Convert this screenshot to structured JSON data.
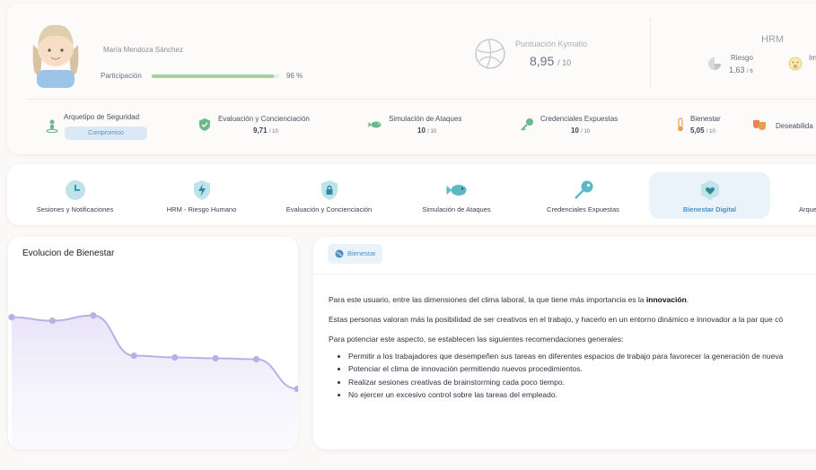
{
  "profile": {
    "name": "María Mendoza Sánchez",
    "participation_label": "Participación",
    "participation_value": "96 %",
    "participation_fraction": 0.96
  },
  "score": {
    "label": "Puntuación Kymatio",
    "value": "8,95",
    "denominator": "/ 10"
  },
  "hrm": {
    "title": "HRM",
    "riesgo_label": "Riesgo",
    "riesgo_value": "1,63",
    "riesgo_den": "/ 6",
    "impacto_label": "Im"
  },
  "metrics": {
    "arquetipo": {
      "label": "Arquetipo de Seguridad",
      "badge": "Compromiso"
    },
    "evaluacion": {
      "label": "Evaluación y Concienciación",
      "value": "9,71",
      "den": "/ 10"
    },
    "simulacion": {
      "label": "Simulación de Ataques",
      "value": "10",
      "den": "/ 10"
    },
    "credenciales": {
      "label": "Credenciales Expuestas",
      "value": "10",
      "den": "/ 10"
    },
    "bienestar": {
      "label": "Bienestar",
      "value": "5,05",
      "den": "/ 10"
    },
    "deseabilidad": {
      "label": "Deseabilida"
    }
  },
  "tabs": [
    {
      "label": "Sesiones y Notificaciones",
      "icon": "clock-icon"
    },
    {
      "label": "HRM - Riesgo Humano",
      "icon": "shield-bolt-icon"
    },
    {
      "label": "Evaluación y Concienciación",
      "icon": "shield-lock-icon"
    },
    {
      "label": "Simulación de Ataques",
      "icon": "fish-icon"
    },
    {
      "label": "Credenciales Expuestas",
      "icon": "key-icon"
    },
    {
      "label": "Bienestar Digital",
      "icon": "heart-shield-icon",
      "active": true
    },
    {
      "label": "Arque",
      "icon": "archetype-icon"
    }
  ],
  "chart": {
    "title": "Evolucion de Bienestar",
    "line_color": "#b8b0e6"
  },
  "chart_data": {
    "type": "area",
    "title": "Evolucion de Bienestar",
    "series": [
      {
        "values": [
          7.3,
          7.1,
          7.4,
          5.1,
          5.0,
          4.95,
          4.9,
          3.2
        ]
      }
    ],
    "ylim": [
      0,
      10
    ]
  },
  "detail": {
    "chip_label": "Bienestar",
    "intro_before": "Para este usuario, entre las dimensiones del clima laboral, la que tiene más importancia es la ",
    "intro_bold": "innovación",
    "intro_after": ".",
    "p2": "Estas personas valoran más la posibilidad de ser creativos en el trabajo, y hacerlo en un entorno dinámico e innovador a la par que có",
    "p3": "Para potenciar este aspecto, se establecen las siguientes recomendaciones generales:",
    "bullets": [
      "Permitir a los trabajadores que desempeñen sus tareas en diferentes espacios de trabajo para favorecer la generación de nueva",
      "Potenciar el clima de innovación permitiendo nuevos procedimientos.",
      "Realizar sesiones creativas de brainstorming cada poco tiempo.",
      "No ejercer un excesivo control sobre las tareas del empleado."
    ]
  },
  "colors": {
    "accent": "#4a90c8",
    "progress": "#9fd39f",
    "teal": "#5bb8c4",
    "orange": "#e8a04a",
    "chart_line": "#b8b0e6"
  }
}
